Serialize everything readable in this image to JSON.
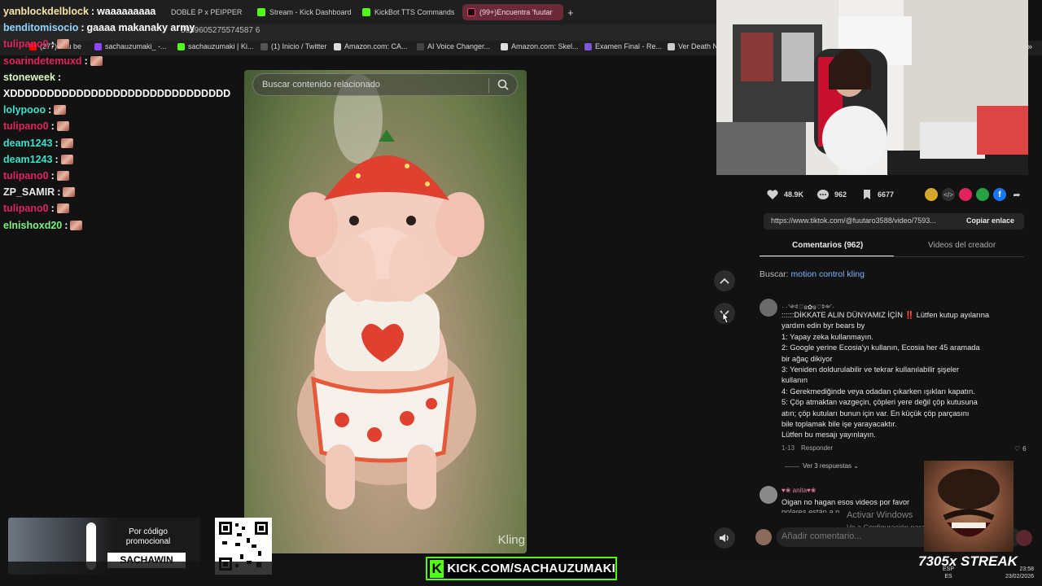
{
  "browser": {
    "tabs": [
      {
        "label": "DOBLE P x PEIPPER",
        "color": "#888888"
      },
      {
        "label": "Stream - Kick Dashboard",
        "color": "#53fc18"
      },
      {
        "label": "KickBot TTS Commands",
        "color": "#53fc18"
      },
      {
        "label": "(99+)Encuentra 'fuutar",
        "color": "#ff3b6b",
        "active": true
      }
    ],
    "url_text": "5939605275574587 6",
    "bookmarks": [
      {
        "label": "(277) You be",
        "color": "#ff0000"
      },
      {
        "label": "sachauzumaki_ -...",
        "color": "#9146ff"
      },
      {
        "label": "sachauzumaki | Ki...",
        "color": "#53fc18"
      },
      {
        "label": "(1) Inicio / Twitter",
        "color": "#cccccc"
      },
      {
        "label": "Amazon.com: CA...",
        "color": "#dddddd"
      },
      {
        "label": "AI Voice Changer...",
        "color": "#cccccc"
      },
      {
        "label": "Amazon.com: Skel...",
        "color": "#dddddd"
      },
      {
        "label": "Examen Final - Re...",
        "color": "#7f56d9"
      },
      {
        "label": "Ver Death N",
        "color": "#cccccc"
      }
    ]
  },
  "video": {
    "search_placeholder": "Buscar contenido relacionado",
    "watermark": "Kling"
  },
  "stats": {
    "likes": "48.9K",
    "comments": "962",
    "saves": "6677"
  },
  "share": {
    "url": "https://www.tiktok.com/@fuutaro3588/video/7593...",
    "copy_label": "Copiar enlace"
  },
  "panel_tabs": {
    "comments": "Comentarios (962)",
    "creator": "Videos del creador"
  },
  "search_suggestion": {
    "prefix": "Buscar:",
    "query": "motion control kling"
  },
  "comment1": {
    "username": "· ·༺♡ɞ✿ɞ♡༻·",
    "lines": [
      "::::::DİKKATE ALIN DÜNYAMIZ İÇİN ‼️ Lütfen kutup ayılarına",
      "yardım edin byr bears by",
      "1: Yapay zeka kullanmayın.",
      "2: Google yerine Ecosia'yı kullanın, Ecosia her 45 aramada",
      "bir ağaç dikiyor",
      "3: Yeniden doldurulabilir ve tekrar kullanılabilir şişeler",
      "kullanın",
      "4: Gerekmediğinde veya odadan çıkarken ışıkları kapatın.",
      "5: Çöp atmaktan vazgeçin, çöpleri yere değil çöp kutusuna",
      "atın; çöp kutuları bunun için var. En küçük çöp parçasını",
      "bile toplamak bile işe yarayacaktır.",
      "Lütfen bu mesajı yayınlayın."
    ],
    "date": "1-13",
    "reply": "Responder",
    "likes": "6",
    "view_replies": "Ver 3 respuestas"
  },
  "comment2": {
    "username": "♥❀ anita♥❀",
    "text": "Oigan no hagan esos videos por favor",
    "text2": "polares están a n..."
  },
  "activate_windows": {
    "title": "Activar Windows",
    "sub": "Ve a Configuración para"
  },
  "add_comment_placeholder": "Añadir comentario...",
  "chat": [
    {
      "user": "yanblockdelblock",
      "color": "#f5e6a6",
      "text": "waaaaaaaaa"
    },
    {
      "user": "benditomisocio",
      "color": "#8fd3ff",
      "text": "gaaaa makanaky army"
    },
    {
      "user": "tulipano0",
      "color": "#e0245e",
      "text": "",
      "emote": true
    },
    {
      "user": "soarindetemuxd",
      "color": "#e0245e",
      "text": "",
      "emote": true
    },
    {
      "user": "stoneweek",
      "color": "#d7f7c4",
      "text": ""
    },
    {
      "user": "",
      "color": "#ffffff",
      "text": "XDDDDDDDDDDDDDDDDDDDDDDDDDDDDDD"
    },
    {
      "user": "lolypooo",
      "color": "#3de0c9",
      "text": "",
      "emote": true
    },
    {
      "user": "tulipano0",
      "color": "#e0245e",
      "text": "",
      "emote": true
    },
    {
      "user": "deam1243",
      "color": "#3de0c9",
      "text": "",
      "emote": true
    },
    {
      "user": "deam1243",
      "color": "#3de0c9",
      "text": "",
      "emote": true
    },
    {
      "user": "tulipano0",
      "color": "#e0245e",
      "text": "",
      "emote": true
    },
    {
      "user": "ZP_SAMIR",
      "color": "#e8e8e8",
      "text": "",
      "emote": true
    },
    {
      "user": "tulipano0",
      "color": "#e0245e",
      "text": "",
      "emote": true
    },
    {
      "user": "elnishoxd20",
      "color": "#7cf57c",
      "text": "",
      "emote": true
    }
  ],
  "promo": {
    "line1": "Por código",
    "line2": "promocional",
    "code": "SACHAWIN"
  },
  "kick_banner": "KICK.COM/SACHAUZUMAKI",
  "streak": "7305x STREAK",
  "taskbar": {
    "lang1": "ESP",
    "lang2": "ES",
    "time": "23:58",
    "date": "23/02/2026"
  }
}
